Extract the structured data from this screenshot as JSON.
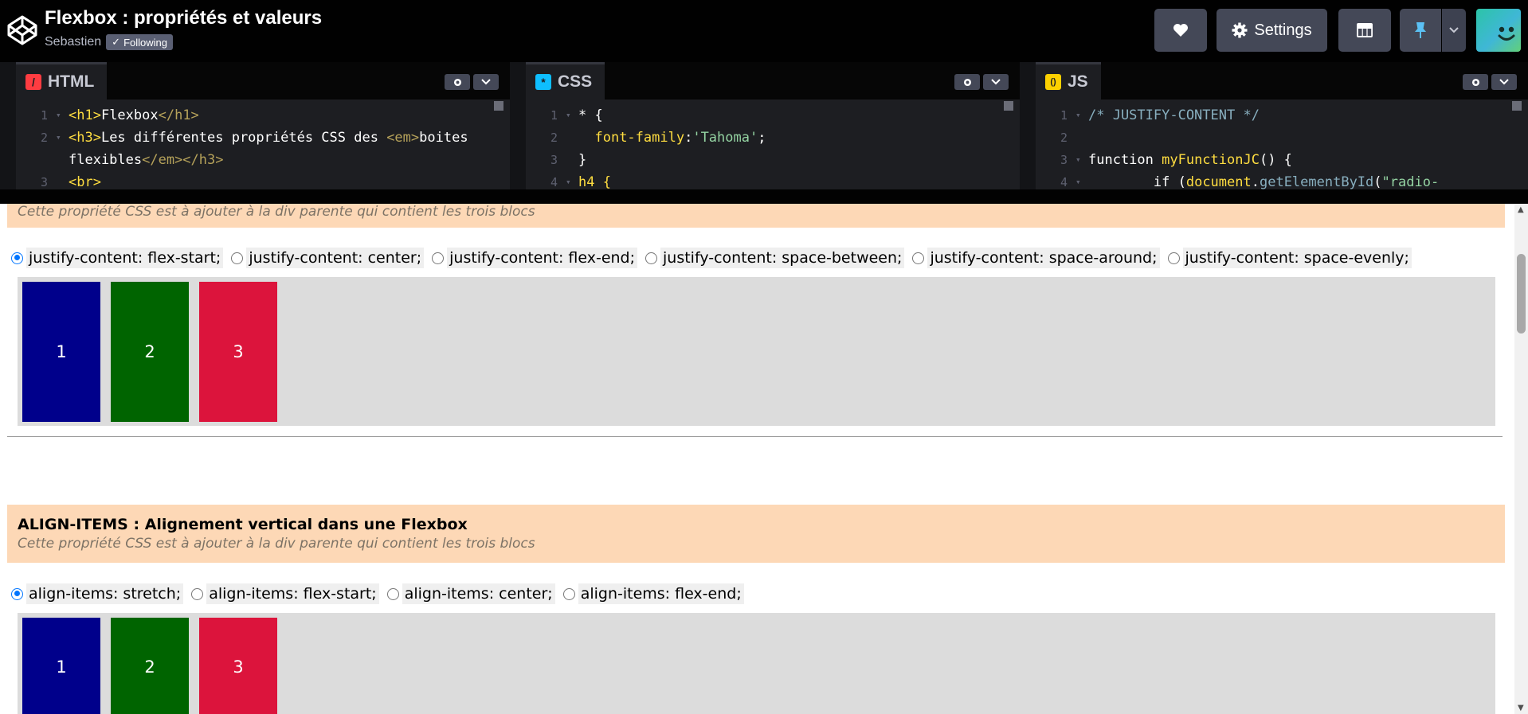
{
  "header": {
    "title": "Flexbox : propriétés et valeurs",
    "author": "Sebastien",
    "following_label": "Following",
    "settings_label": "Settings"
  },
  "editors": {
    "html": {
      "tab_label": "HTML",
      "badge": "/",
      "badge_color": "#ff3c41",
      "lines": [
        {
          "n": "1",
          "fold": "▾"
        },
        {
          "n": "2",
          "fold": "▾"
        },
        {
          "n": "",
          "fold": ""
        },
        {
          "n": "3",
          "fold": ""
        }
      ]
    },
    "css": {
      "tab_label": "CSS",
      "badge": "*",
      "badge_color": "#0ebeff",
      "lines": [
        {
          "n": "1",
          "fold": "▾"
        },
        {
          "n": "2",
          "fold": ""
        },
        {
          "n": "3",
          "fold": ""
        },
        {
          "n": "4",
          "fold": "▾"
        }
      ]
    },
    "js": {
      "tab_label": "JS",
      "badge": "()",
      "badge_color": "#fcd000",
      "lines": [
        {
          "n": "1",
          "fold": "▾"
        },
        {
          "n": "2",
          "fold": ""
        },
        {
          "n": "3",
          "fold": "▾"
        },
        {
          "n": "4",
          "fold": "▾"
        }
      ]
    }
  },
  "code": {
    "html": {
      "l1_open": "<h1>",
      "l1_text": "Flexbox",
      "l1_close": "</h1>",
      "l2_open": "<h3>",
      "l2_text": "Les différentes propriétés CSS des ",
      "l2_em": "<em>",
      "l2_text2": "boites",
      "l2b_text": "flexibles",
      "l2b_close": "</em></h3>",
      "l3": "<br>"
    },
    "css": {
      "l1": "* {",
      "l2_prop": "font-family",
      "l2_colon": ":",
      "l2_val": "'Tahoma'",
      "l2_semi": ";",
      "l3": "}",
      "l4": "h4 {"
    },
    "js": {
      "l1": "/* JUSTIFY-CONTENT */",
      "l3_kw": "function ",
      "l3_fn": "myFunctionJC",
      "l3_rest": "() {",
      "l4_kw": "if (",
      "l4_obj": "document",
      "l4_dot": ".",
      "l4_fn": "getElementById",
      "l4_paren": "(",
      "l4_str": "\"radio-"
    }
  },
  "preview": {
    "section1": {
      "subtitle": "Cette propriété CSS est à ajouter à la div parente qui contient les trois blocs",
      "options": [
        {
          "label": "justify-content: flex-start;",
          "checked": true
        },
        {
          "label": "justify-content: center;",
          "checked": false
        },
        {
          "label": "justify-content: flex-end;",
          "checked": false
        },
        {
          "label": "justify-content: space-between;",
          "checked": false
        },
        {
          "label": "justify-content: space-around;",
          "checked": false
        },
        {
          "label": "justify-content: space-evenly;",
          "checked": false
        }
      ],
      "items": [
        "1",
        "2",
        "3"
      ]
    },
    "section2": {
      "title": "ALIGN-ITEMS : Alignement vertical dans une Flexbox",
      "subtitle": "Cette propriété CSS est à ajouter à la div parente qui contient les trois blocs",
      "options": [
        {
          "label": "align-items: stretch;",
          "checked": true
        },
        {
          "label": "align-items: flex-start;",
          "checked": false
        },
        {
          "label": "align-items: center;",
          "checked": false
        },
        {
          "label": "align-items: flex-end;",
          "checked": false
        }
      ],
      "items": [
        "1",
        "2",
        "3"
      ]
    },
    "colors": {
      "item1": "#00008b",
      "item2": "#006400",
      "item3": "#dc143c",
      "section_bg": "#fdd8b6",
      "box_bg": "#dcdcdc"
    }
  },
  "icons": {
    "logo": "codepen-logo-icon",
    "heart": "heart-icon",
    "gear": "gear-icon",
    "layout": "layout-icon",
    "pin": "pin-icon",
    "caret": "chevron-down-icon"
  }
}
